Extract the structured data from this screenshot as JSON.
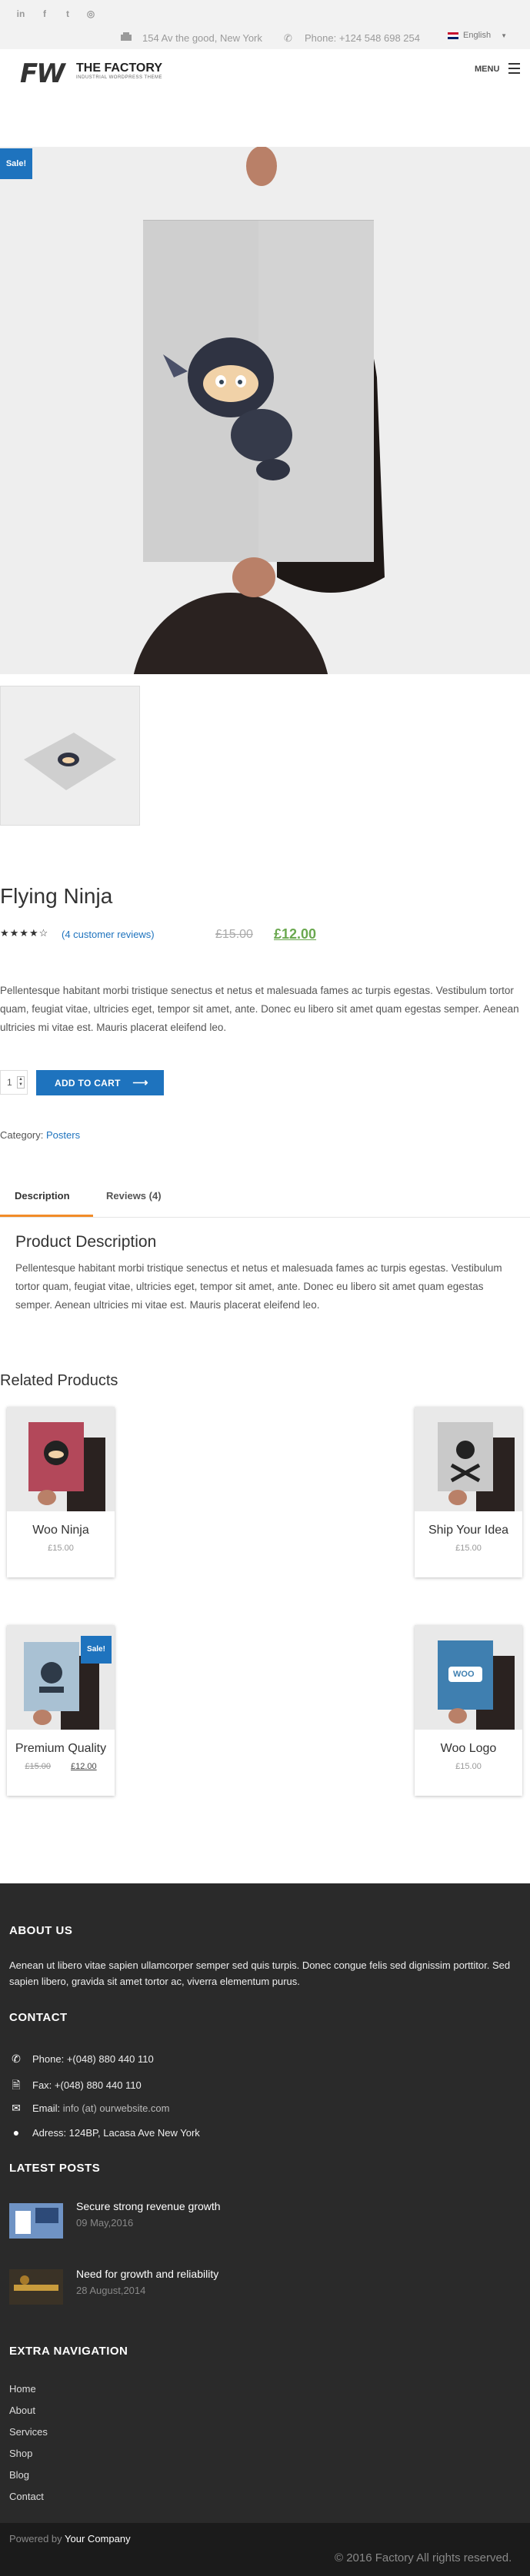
{
  "topbar": {
    "social": [
      {
        "icon": "linkedin-icon",
        "glyph": "in"
      },
      {
        "icon": "facebook-icon",
        "glyph": "f"
      },
      {
        "icon": "twitter-icon",
        "glyph": "t"
      },
      {
        "icon": "instagram-icon",
        "glyph": "◎"
      }
    ],
    "address": "154 Av the good, New York",
    "phone": "Phone: +124 548 698 254",
    "language": "English"
  },
  "header": {
    "logo_mark": "FW",
    "logo_title": "THE FACTORY",
    "logo_subtitle": "INDUSTRIAL WORDPRESS THEME",
    "menu_label": "MENU"
  },
  "product": {
    "sale_badge": "Sale!",
    "title": "Flying Ninja",
    "stars": "★★★★☆",
    "rating": 4,
    "reviews_link": "(4 customer reviews)",
    "old_price": "£15.00",
    "new_price": "£12.00",
    "description": "Pellentesque habitant morbi tristique senectus et netus et malesuada fames ac turpis egestas. Vestibulum tortor quam, feugiat vitae, ultricies eget, tempor sit amet, ante. Donec eu libero sit amet quam egestas semper. Aenean ultricies mi vitae est. Mauris placerat eleifend leo.",
    "quantity": "1",
    "add_to_cart": "ADD TO CART",
    "category_label": "Category:",
    "category_value": "Posters"
  },
  "tabs": {
    "description": "Description",
    "reviews": "Reviews (4)",
    "heading": "Product Description",
    "text": "Pellentesque habitant morbi tristique senectus et netus et malesuada fames ac turpis egestas. Vestibulum tortor quam, feugiat vitae, ultricies eget, tempor sit amet, ante. Donec eu libero sit amet quam egestas semper. Aenean ultricies mi vitae est. Mauris placerat eleifend leo."
  },
  "related": {
    "heading": "Related Products",
    "items": [
      {
        "name": "Woo Ninja",
        "price": "£15.00"
      },
      {
        "name": "Ship Your Idea",
        "price": "£15.00"
      },
      {
        "name": "Premium Quality",
        "old_price": "£15.00",
        "price": "£12.00",
        "sale": "Sale!"
      },
      {
        "name": "Woo Logo",
        "price": "£15.00",
        "poster_text": "WOO"
      }
    ]
  },
  "footer": {
    "about_heading": "ABOUT US",
    "about_text": "Aenean ut libero vitae sapien ullamcorper semper sed quis turpis. Donec congue felis sed dignissim porttitor. Sed sapien libero, gravida sit amet tortor ac, viverra elementum purus.",
    "contact_heading": "CONTACT",
    "contact": {
      "phone": "Phone: +(048) 880 440 110",
      "fax": "Fax: +(048) 880 440 110",
      "email_label": "Email:",
      "email_value": "info (at) ourwebsite.com",
      "address": "Adress: 124BP, Lacasa Ave New York"
    },
    "posts_heading": "LATEST POSTS",
    "posts": [
      {
        "title": "Secure strong revenue growth",
        "date": "09 May,2016"
      },
      {
        "title": "Need for growth and reliability",
        "date": "28 August,2014"
      }
    ],
    "nav_heading": "EXTRA NAVIGATION",
    "nav": [
      "Home",
      "About",
      "Services",
      "Shop",
      "Blog",
      "Contact"
    ],
    "powered_prefix": "Powered by",
    "powered_company": "Your Company",
    "copyright": "© 2016 Factory All rights reserved."
  },
  "colors": {
    "accent": "#1e73be",
    "sale_price": "#6aa84f",
    "tab_active": "#f28c28",
    "footer_bg": "#2a2a2a"
  }
}
